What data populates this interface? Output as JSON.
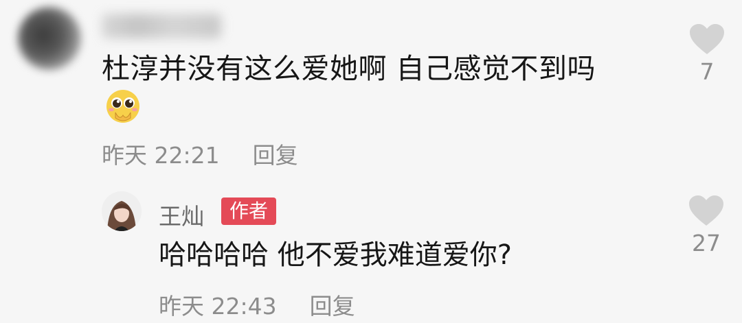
{
  "comment": {
    "text": "杜淳并没有这么爱她啊 自己感觉不到吗",
    "emoji": "pleading-face-emoji",
    "time": "昨天 22:21",
    "reply_label": "回复",
    "like_count": "7"
  },
  "reply": {
    "username": "王灿",
    "badge": "作者",
    "text": "哈哈哈哈 他不爱我难道爱你?",
    "time": "昨天 22:43",
    "reply_label": "回复",
    "like_count": "27"
  },
  "colors": {
    "background": "#f6f6f6",
    "text": "#161616",
    "meta": "#8c8c8c",
    "heart": "#d3d3d3",
    "badge": "#e44a57"
  }
}
